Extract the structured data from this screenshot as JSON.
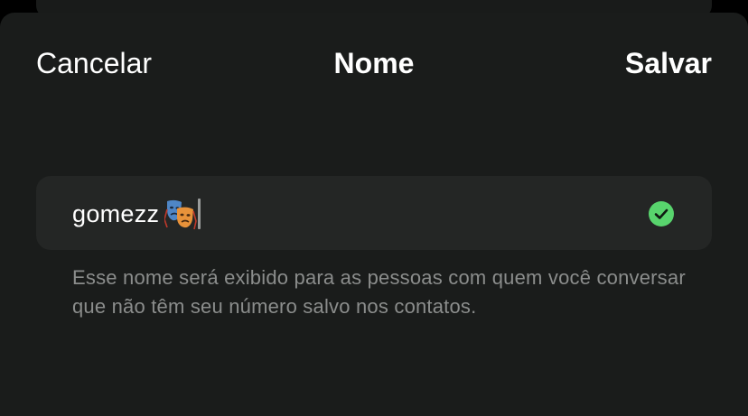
{
  "nav": {
    "cancel_label": "Cancelar",
    "title": "Nome",
    "save_label": "Salvar"
  },
  "name_field": {
    "value": "gomezz",
    "emoji": "🎭",
    "status_icon": "check-circle-icon",
    "status_color": "#58d46d"
  },
  "helper_text": "Esse nome será exibido para as pessoas com quem você conversar que não têm seu número salvo nos contatos.",
  "colors": {
    "background": "#000000",
    "sheet": "#1a1c1b",
    "field": "#242625",
    "text_primary": "#ffffff",
    "text_secondary": "#8b8d8c"
  }
}
